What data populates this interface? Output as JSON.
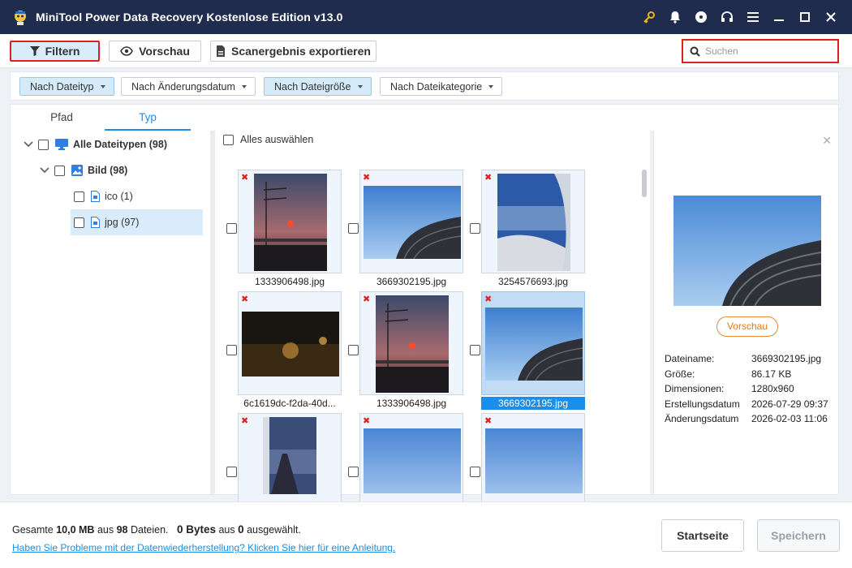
{
  "app": {
    "title": "MiniTool Power Data Recovery Kostenlose Edition v13.0"
  },
  "toolbar": {
    "filter_label": "Filtern",
    "preview_label": "Vorschau",
    "export_label": "Scanergebnis exportieren",
    "search_placeholder": "Suchen"
  },
  "filters": [
    {
      "label": "Nach Dateityp",
      "active": true
    },
    {
      "label": "Nach Änderungsdatum",
      "active": false
    },
    {
      "label": "Nach Dateigröße",
      "active": true
    },
    {
      "label": "Nach Dateikategorie",
      "active": false
    }
  ],
  "tabs": {
    "path": "Pfad",
    "type": "Typ"
  },
  "tree": {
    "all": "Alle Dateitypen (98)",
    "image": "Bild (98)",
    "ico": "ico (1)",
    "jpg": "jpg (97)"
  },
  "grid": {
    "select_all": "Alles auswählen",
    "files": [
      {
        "name": "1333906498.jpg",
        "kind": "sunset"
      },
      {
        "name": "3669302195.jpg",
        "kind": "stadium"
      },
      {
        "name": "3254576693.jpg",
        "kind": "plane"
      },
      {
        "name": "6c1619dc-f2da-40d...",
        "kind": "night"
      },
      {
        "name": "1333906498.jpg",
        "kind": "sunset"
      },
      {
        "name": "3669302195.jpg",
        "kind": "stadium",
        "selected": true
      },
      {
        "name": "",
        "kind": "tower"
      },
      {
        "name": "",
        "kind": "sky"
      },
      {
        "name": "",
        "kind": "sky"
      }
    ]
  },
  "preview": {
    "button": "Vorschau",
    "info": [
      {
        "key": "Dateiname:",
        "value": "3669302195.jpg"
      },
      {
        "key": "Größe:",
        "value": "86.17 KB"
      },
      {
        "key": "Dimensionen:",
        "value": "1280x960"
      },
      {
        "key": "Erstellungsdatum",
        "value": "2026-07-29 09:37"
      },
      {
        "key": "Änderungsdatum",
        "value": "2026-02-03 11:06"
      }
    ]
  },
  "footer": {
    "total_prefix": "Gesamte",
    "total_size": "10,0 MB",
    "total_mid": "aus",
    "total_count": "98",
    "total_suffix": "Dateien.",
    "selected_size": "0 Bytes",
    "selected_mid": "aus",
    "selected_count": "0",
    "selected_suffix": "ausgewählt.",
    "help_link": "Haben Sie Probleme mit der Datenwiederherstellung? Klicken Sie hier für eine Anleitung.",
    "home_button": "Startseite",
    "save_button": "Speichern"
  },
  "colors": {
    "titlebar": "#1f2c4d",
    "accent": "#1a8ee8",
    "highlight": "#e0201f",
    "preview_button": "#e07a1c"
  }
}
